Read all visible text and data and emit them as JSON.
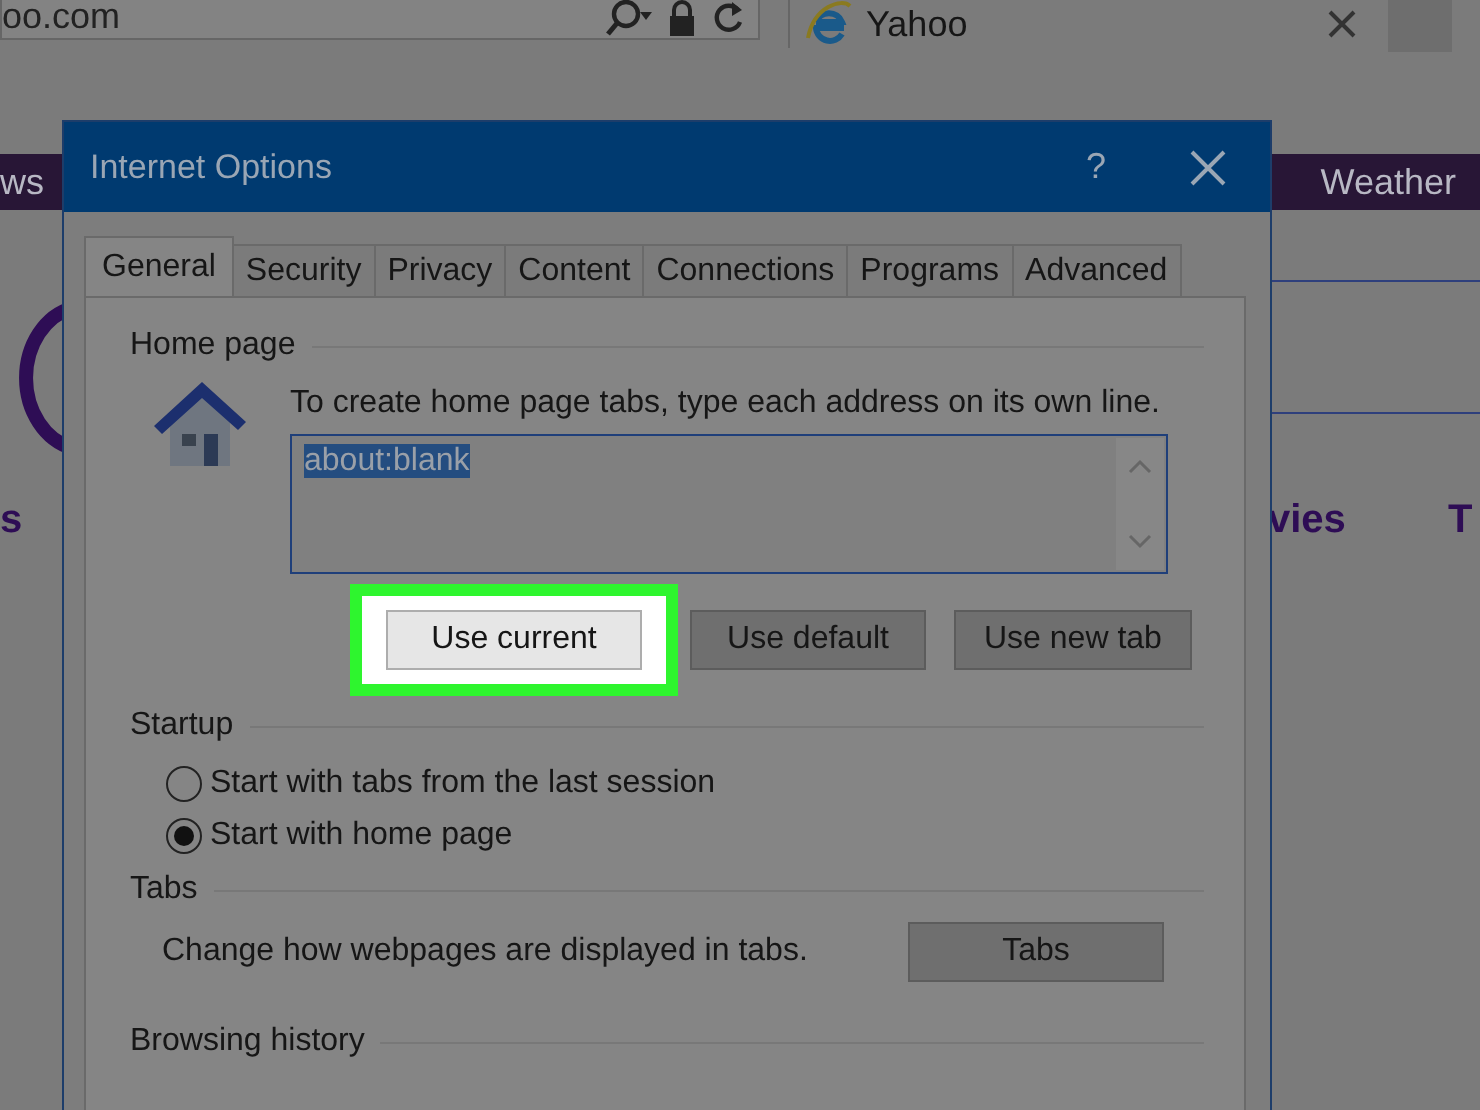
{
  "browser": {
    "address": "oo.com",
    "tab_title": "Yahoo",
    "nav_items": [
      "ws",
      "Weather"
    ],
    "page_links": [
      "s",
      "vies",
      "T"
    ]
  },
  "dialog": {
    "title": "Internet Options",
    "help": "?",
    "tabs": [
      {
        "label": "General",
        "selected": true
      },
      {
        "label": "Security",
        "selected": false
      },
      {
        "label": "Privacy",
        "selected": false
      },
      {
        "label": "Content",
        "selected": false
      },
      {
        "label": "Connections",
        "selected": false
      },
      {
        "label": "Programs",
        "selected": false
      },
      {
        "label": "Advanced",
        "selected": false
      }
    ],
    "home_page": {
      "heading": "Home page",
      "instruction": "To create home page tabs, type each address on its own line.",
      "value": "about:blank",
      "value_selected": true,
      "buttons": [
        {
          "label": "Use current",
          "highlighted": true
        },
        {
          "label": "Use default",
          "highlighted": false
        },
        {
          "label": "Use new tab",
          "highlighted": false
        }
      ]
    },
    "startup": {
      "heading": "Startup",
      "options": [
        {
          "label": "Start with tabs from the last session",
          "selected": false
        },
        {
          "label": "Start with home page",
          "selected": true
        }
      ]
    },
    "tabs_section": {
      "heading": "Tabs",
      "description": "Change how webpages are displayed in tabs.",
      "button": "Tabs"
    },
    "browsing_history": {
      "heading": "Browsing history"
    }
  }
}
